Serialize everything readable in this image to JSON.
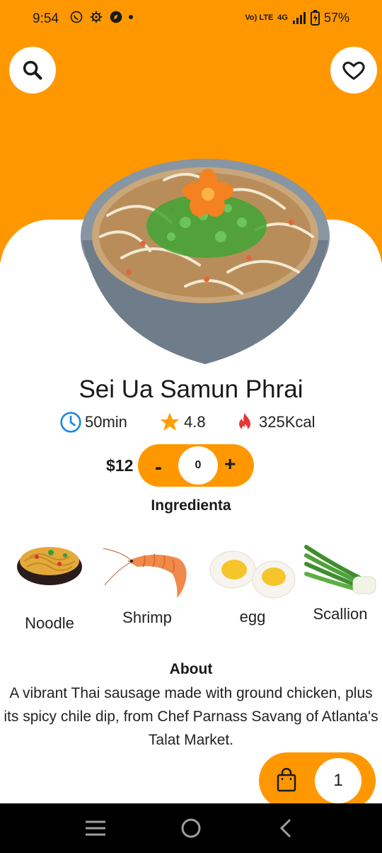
{
  "status_bar": {
    "time": "9:54",
    "network": "4G",
    "battery": "57%",
    "volte": "Vo) LTE"
  },
  "header": {
    "search_icon": "search-icon",
    "favorite_icon": "heart-icon"
  },
  "dish": {
    "name": "Sei Ua Samun Phrai",
    "time": "50min",
    "rating": "4.8",
    "calories": "325Kcal",
    "price": "$12",
    "quantity": "0",
    "minus_label": "-",
    "plus_label": "+"
  },
  "ingredients": {
    "title": "Ingredienta",
    "items": [
      {
        "name": "Noodle"
      },
      {
        "name": "Shrimp"
      },
      {
        "name": "egg"
      },
      {
        "name": "Scallion"
      }
    ]
  },
  "about": {
    "title": "About",
    "text": "A vibrant Thai sausage made with ground chicken, plus its spicy chile dip, from Chef Parnass Savang of Atlanta's Talat Market."
  },
  "cart": {
    "count": "1",
    "icon": "shopping-bag-icon"
  },
  "colors": {
    "accent": "#FF9800",
    "clock": "#1E88E5",
    "star": "#FFA000",
    "flame": "#E53935"
  }
}
